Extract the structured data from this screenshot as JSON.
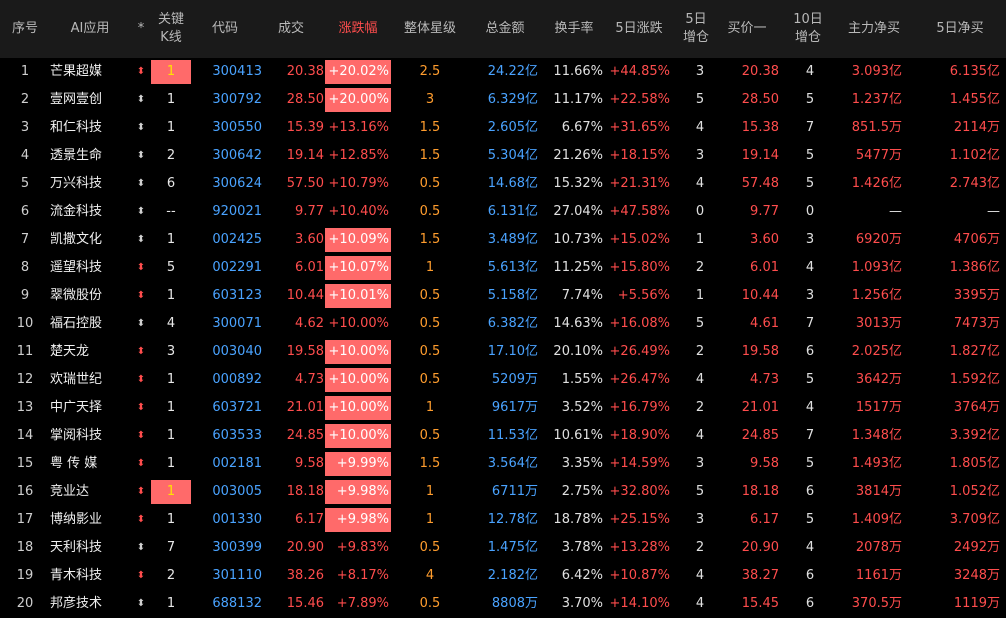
{
  "columns": {
    "seq": "序号",
    "name": "AI应用",
    "flag": "*",
    "kline": "关键\nK线",
    "code": "代码",
    "price": "成交",
    "pct": "涨跌幅",
    "star": "整体星级",
    "amount": "总金额",
    "turnover": "换手率",
    "rise5": "5日涨跌",
    "add5": "5日\n增仓",
    "buy1": "买价一",
    "add10": "10日\n增仓",
    "main": "主力净买",
    "net5": "5日净买"
  },
  "rows": [
    {
      "seq": "1",
      "name": "芒果超媒",
      "flag": "red",
      "kline": "1",
      "kline_hl": true,
      "code": "300413",
      "price": "20.38",
      "pct": "+20.02%",
      "pct_hl": true,
      "star": "2.5",
      "amount": "24.22亿",
      "turnover": "11.66%",
      "rise5": "+44.85%",
      "add5": "3",
      "buy1": "20.38",
      "add10": "4",
      "main": "3.093亿",
      "net5": "6.135亿"
    },
    {
      "seq": "2",
      "name": "壹网壹创",
      "flag": "white",
      "kline": "1",
      "kline_hl": false,
      "code": "300792",
      "price": "28.50",
      "pct": "+20.00%",
      "pct_hl": true,
      "star": "3",
      "amount": "6.329亿",
      "turnover": "11.17%",
      "rise5": "+22.58%",
      "add5": "5",
      "buy1": "28.50",
      "add10": "5",
      "main": "1.237亿",
      "net5": "1.455亿"
    },
    {
      "seq": "3",
      "name": "和仁科技",
      "flag": "white",
      "kline": "1",
      "kline_hl": false,
      "code": "300550",
      "price": "15.39",
      "pct": "+13.16%",
      "pct_hl": false,
      "star": "1.5",
      "amount": "2.605亿",
      "turnover": "6.67%",
      "rise5": "+31.65%",
      "add5": "4",
      "buy1": "15.38",
      "add10": "7",
      "main": "851.5万",
      "net5": "2114万"
    },
    {
      "seq": "4",
      "name": "透景生命",
      "flag": "white",
      "kline": "2",
      "kline_hl": false,
      "code": "300642",
      "price": "19.14",
      "pct": "+12.85%",
      "pct_hl": false,
      "star": "1.5",
      "amount": "5.304亿",
      "turnover": "21.26%",
      "rise5": "+18.15%",
      "add5": "3",
      "buy1": "19.14",
      "add10": "5",
      "main": "5477万",
      "net5": "1.102亿"
    },
    {
      "seq": "5",
      "name": "万兴科技",
      "flag": "white",
      "kline": "6",
      "kline_hl": false,
      "code": "300624",
      "price": "57.50",
      "pct": "+10.79%",
      "pct_hl": false,
      "star": "0.5",
      "amount": "14.68亿",
      "turnover": "15.32%",
      "rise5": "+21.31%",
      "add5": "4",
      "buy1": "57.48",
      "add10": "5",
      "main": "1.426亿",
      "net5": "2.743亿"
    },
    {
      "seq": "6",
      "name": "流金科技",
      "flag": "white",
      "kline": "--",
      "kline_hl": false,
      "code": "920021",
      "price": "9.77",
      "pct": "+10.40%",
      "pct_hl": false,
      "star": "0.5",
      "amount": "6.131亿",
      "turnover": "27.04%",
      "rise5": "+47.58%",
      "add5": "0",
      "buy1": "9.77",
      "add10": "0",
      "main": "—",
      "net5": "—"
    },
    {
      "seq": "7",
      "name": "凯撒文化",
      "flag": "white",
      "kline": "1",
      "kline_hl": false,
      "code": "002425",
      "price": "3.60",
      "pct": "+10.09%",
      "pct_hl": true,
      "star": "1.5",
      "amount": "3.489亿",
      "turnover": "10.73%",
      "rise5": "+15.02%",
      "add5": "1",
      "buy1": "3.60",
      "add10": "3",
      "main": "6920万",
      "net5": "4706万"
    },
    {
      "seq": "8",
      "name": "遥望科技",
      "flag": "red",
      "kline": "5",
      "kline_hl": false,
      "code": "002291",
      "price": "6.01",
      "pct": "+10.07%",
      "pct_hl": true,
      "star": "1",
      "amount": "5.613亿",
      "turnover": "11.25%",
      "rise5": "+15.80%",
      "add5": "2",
      "buy1": "6.01",
      "add10": "4",
      "main": "1.093亿",
      "net5": "1.386亿"
    },
    {
      "seq": "9",
      "name": "翠微股份",
      "flag": "red",
      "kline": "1",
      "kline_hl": false,
      "code": "603123",
      "price": "10.44",
      "pct": "+10.01%",
      "pct_hl": true,
      "star": "0.5",
      "amount": "5.158亿",
      "turnover": "7.74%",
      "rise5": "+5.56%",
      "add5": "1",
      "buy1": "10.44",
      "add10": "3",
      "main": "1.256亿",
      "net5": "3395万"
    },
    {
      "seq": "10",
      "name": "福石控股",
      "flag": "white",
      "kline": "4",
      "kline_hl": false,
      "code": "300071",
      "price": "4.62",
      "pct": "+10.00%",
      "pct_hl": false,
      "star": "0.5",
      "amount": "6.382亿",
      "turnover": "14.63%",
      "rise5": "+16.08%",
      "add5": "5",
      "buy1": "4.61",
      "add10": "7",
      "main": "3013万",
      "net5": "7473万"
    },
    {
      "seq": "11",
      "name": "楚天龙",
      "flag": "red",
      "kline": "3",
      "kline_hl": false,
      "code": "003040",
      "price": "19.58",
      "pct": "+10.00%",
      "pct_hl": true,
      "star": "0.5",
      "amount": "17.10亿",
      "turnover": "20.10%",
      "rise5": "+26.49%",
      "add5": "2",
      "buy1": "19.58",
      "add10": "6",
      "main": "2.025亿",
      "net5": "1.827亿"
    },
    {
      "seq": "12",
      "name": "欢瑞世纪",
      "flag": "red",
      "kline": "1",
      "kline_hl": false,
      "code": "000892",
      "price": "4.73",
      "pct": "+10.00%",
      "pct_hl": true,
      "star": "0.5",
      "amount": "5209万",
      "turnover": "1.55%",
      "rise5": "+26.47%",
      "add5": "4",
      "buy1": "4.73",
      "add10": "5",
      "main": "3642万",
      "net5": "1.592亿"
    },
    {
      "seq": "13",
      "name": "中广天择",
      "flag": "red",
      "kline": "1",
      "kline_hl": false,
      "code": "603721",
      "price": "21.01",
      "pct": "+10.00%",
      "pct_hl": true,
      "star": "1",
      "amount": "9617万",
      "turnover": "3.52%",
      "rise5": "+16.79%",
      "add5": "2",
      "buy1": "21.01",
      "add10": "4",
      "main": "1517万",
      "net5": "3764万"
    },
    {
      "seq": "14",
      "name": "掌阅科技",
      "flag": "red",
      "kline": "1",
      "kline_hl": false,
      "code": "603533",
      "price": "24.85",
      "pct": "+10.00%",
      "pct_hl": true,
      "star": "0.5",
      "amount": "11.53亿",
      "turnover": "10.61%",
      "rise5": "+18.90%",
      "add5": "4",
      "buy1": "24.85",
      "add10": "7",
      "main": "1.348亿",
      "net5": "3.392亿"
    },
    {
      "seq": "15",
      "name": "粤 传 媒",
      "flag": "red",
      "kline": "1",
      "kline_hl": false,
      "code": "002181",
      "price": "9.58",
      "pct": "+9.99%",
      "pct_hl": true,
      "star": "1.5",
      "amount": "3.564亿",
      "turnover": "3.35%",
      "rise5": "+14.59%",
      "add5": "3",
      "buy1": "9.58",
      "add10": "5",
      "main": "1.493亿",
      "net5": "1.805亿"
    },
    {
      "seq": "16",
      "name": "竞业达",
      "flag": "red",
      "kline": "1",
      "kline_hl": true,
      "code": "003005",
      "price": "18.18",
      "pct": "+9.98%",
      "pct_hl": true,
      "star": "1",
      "amount": "6711万",
      "turnover": "2.75%",
      "rise5": "+32.80%",
      "add5": "5",
      "buy1": "18.18",
      "add10": "6",
      "main": "3814万",
      "net5": "1.052亿"
    },
    {
      "seq": "17",
      "name": "博纳影业",
      "flag": "red",
      "kline": "1",
      "kline_hl": false,
      "code": "001330",
      "price": "6.17",
      "pct": "+9.98%",
      "pct_hl": true,
      "star": "1",
      "amount": "12.78亿",
      "turnover": "18.78%",
      "rise5": "+25.15%",
      "add5": "3",
      "buy1": "6.17",
      "add10": "5",
      "main": "1.409亿",
      "net5": "3.709亿"
    },
    {
      "seq": "18",
      "name": "天利科技",
      "flag": "white",
      "kline": "7",
      "kline_hl": false,
      "code": "300399",
      "price": "20.90",
      "pct": "+9.83%",
      "pct_hl": false,
      "star": "0.5",
      "amount": "1.475亿",
      "turnover": "3.78%",
      "rise5": "+13.28%",
      "add5": "2",
      "buy1": "20.90",
      "add10": "4",
      "main": "2078万",
      "net5": "2492万"
    },
    {
      "seq": "19",
      "name": "青木科技",
      "flag": "red",
      "kline": "2",
      "kline_hl": false,
      "code": "301110",
      "price": "38.26",
      "pct": "+8.17%",
      "pct_hl": false,
      "star": "4",
      "amount": "2.182亿",
      "turnover": "6.42%",
      "rise5": "+10.87%",
      "add5": "4",
      "buy1": "38.27",
      "add10": "6",
      "main": "1161万",
      "net5": "3248万"
    },
    {
      "seq": "20",
      "name": "邦彦技术",
      "flag": "white",
      "kline": "1",
      "kline_hl": false,
      "code": "688132",
      "price": "15.46",
      "pct": "+7.89%",
      "pct_hl": false,
      "star": "0.5",
      "amount": "8808万",
      "turnover": "3.70%",
      "rise5": "+14.10%",
      "add5": "4",
      "buy1": "15.45",
      "add10": "6",
      "main": "370.5万",
      "net5": "1119万"
    }
  ]
}
